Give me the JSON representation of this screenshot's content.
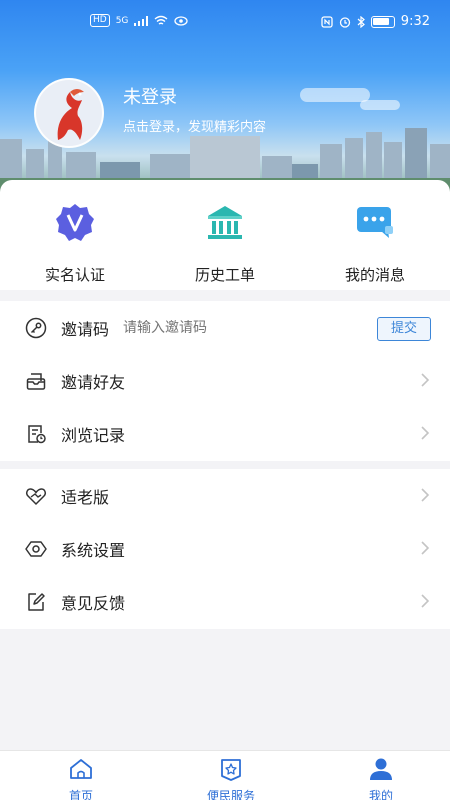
{
  "status_bar": {
    "left_indicators": [
      "HD",
      "5G"
    ],
    "time": "9:32"
  },
  "profile": {
    "name": "未登录",
    "subtitle": "点击登录，发现精彩内容"
  },
  "quick_actions": [
    {
      "label": "实名认证",
      "icon": "verified-badge-icon"
    },
    {
      "label": "历史工单",
      "icon": "bank-building-icon"
    },
    {
      "label": "我的消息",
      "icon": "chat-bubble-icon"
    }
  ],
  "invite_code": {
    "label": "邀请码",
    "placeholder": "请输入邀请码",
    "submit_label": "提交"
  },
  "menu_group1": [
    {
      "label": "邀请好友",
      "icon": "envelope-icon"
    },
    {
      "label": "浏览记录",
      "icon": "history-doc-icon"
    }
  ],
  "menu_group2": [
    {
      "label": "适老版",
      "icon": "heart-hands-icon"
    },
    {
      "label": "系统设置",
      "icon": "hexagon-settings-icon"
    },
    {
      "label": "意见反馈",
      "icon": "edit-icon"
    }
  ],
  "bottom_nav": [
    {
      "label": "首页",
      "icon": "home-icon",
      "active": false
    },
    {
      "label": "便民服务",
      "icon": "service-icon",
      "active": false
    },
    {
      "label": "我的",
      "icon": "user-icon",
      "active": true
    }
  ],
  "colors": {
    "accent": "#2e6fd6",
    "quick_icon_purple": "#5b5fe0",
    "quick_icon_teal": "#2bb7b0",
    "quick_icon_blue": "#3aa3ea",
    "submit_border": "#3d86d8"
  }
}
